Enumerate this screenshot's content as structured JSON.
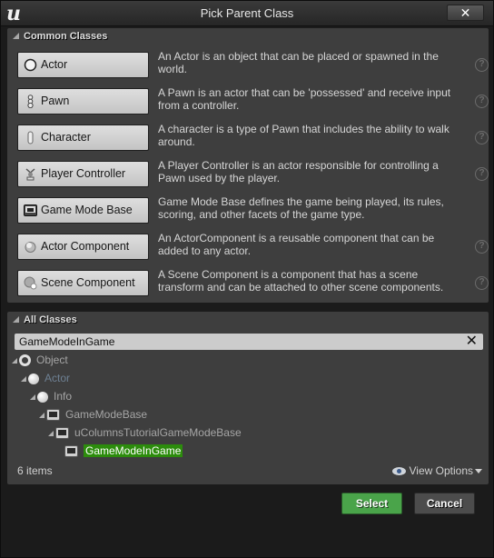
{
  "window": {
    "title": "Pick Parent Class",
    "close_label": "✕",
    "logo_glyph": "u"
  },
  "common_classes": {
    "header": "Common Classes",
    "items": [
      {
        "label": "Actor",
        "icon": "actor-icon",
        "description": "An Actor is an object that can be placed or spawned in the world.",
        "has_help": true
      },
      {
        "label": "Pawn",
        "icon": "pawn-icon",
        "description": "A Pawn is an actor that can be 'possessed' and receive input from a controller.",
        "has_help": true
      },
      {
        "label": "Character",
        "icon": "character-icon",
        "description": "A character is a type of Pawn that includes the ability to walk around.",
        "has_help": true
      },
      {
        "label": "Player Controller",
        "icon": "player-controller-icon",
        "description": "A Player Controller is an actor responsible for controlling a Pawn used by the player.",
        "has_help": true
      },
      {
        "label": "Game Mode Base",
        "icon": "game-mode-icon",
        "description": "Game Mode Base defines the game being played, its rules, scoring, and other facets of the game type.",
        "has_help": false
      },
      {
        "label": "Actor Component",
        "icon": "actor-component-icon",
        "description": "An ActorComponent is a reusable component that can be added to any actor.",
        "has_help": true
      },
      {
        "label": "Scene Component",
        "icon": "scene-component-icon",
        "description": "A Scene Component is a component that has a scene transform and can be attached to other scene components.",
        "has_help": true
      }
    ],
    "help_glyph": "?"
  },
  "all_classes": {
    "header": "All Classes",
    "search": {
      "value": "GameModeInGame",
      "clear_glyph": "✕"
    },
    "tree": [
      {
        "label": "Object",
        "icon": "object-icon",
        "style": "gray"
      },
      {
        "label": "Actor",
        "icon": "actor-icon",
        "style": "blue"
      },
      {
        "label": "Info",
        "icon": "info-icon",
        "style": "gray"
      },
      {
        "label": "GameModeBase",
        "icon": "game-mode-icon",
        "style": "gray"
      },
      {
        "label": "uColumnsTutorialGameModeBase",
        "icon": "game-mode-icon",
        "style": "gray"
      },
      {
        "label": "GameModeInGame",
        "icon": "game-mode-icon",
        "style": "selected"
      }
    ],
    "items_count": "6 items",
    "view_options": "View Options"
  },
  "footer": {
    "select_label": "Select",
    "cancel_label": "Cancel"
  },
  "colors": {
    "accent_green": "#4aa44a",
    "selection_green": "#2c8c0c",
    "panel_bg": "#3e3e3e"
  }
}
